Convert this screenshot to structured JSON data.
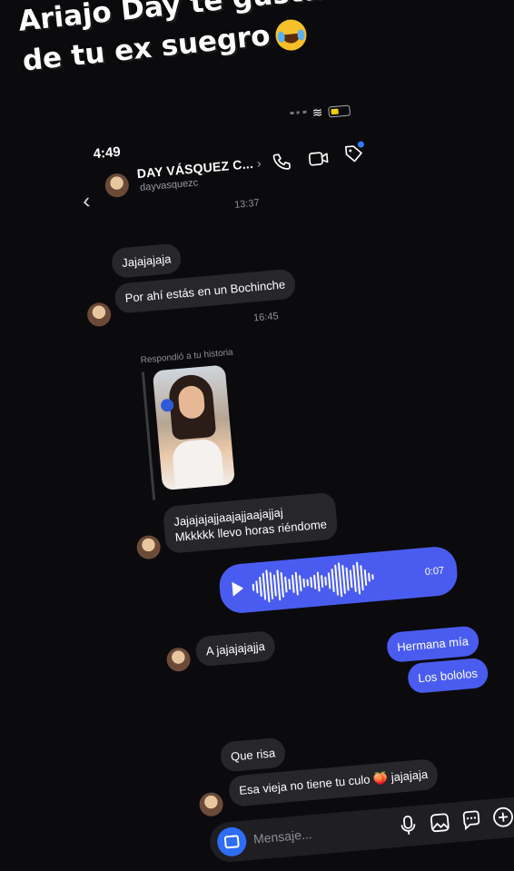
{
  "caption": "Ariajo Day te gusta los bololos de tu ex suegro",
  "status": {
    "time": "4:49"
  },
  "header": {
    "name": "DAY VÁSQUEZ C...",
    "chevron": "›",
    "username": "dayvasquezc",
    "back_icon": "‹"
  },
  "times": [
    "13:37",
    "16:45"
  ],
  "messages": {
    "m1": "Jajajajaja",
    "m2": "Por ahí estás en un Bochinche",
    "reply_label": "Respondió a tu historia",
    "m3_line1": "Jajajajajjaajajjaajajjaj",
    "m3_line2": "Mkkkkk llevo horas riéndome",
    "voice_duration": "0:07",
    "m4": "A jajajajajja",
    "out1": "Hermana mía",
    "out2": "Los bololos",
    "m5": "Que risa",
    "m6": "Esa vieja no tiene tu culo 🍑 jajajaja"
  },
  "composer": {
    "placeholder": "Mensaje..."
  },
  "icons": [
    "back-icon",
    "phone-icon",
    "video-icon",
    "tag-icon",
    "camera-icon",
    "mic-icon",
    "image-icon",
    "sticker-icon",
    "plus-icon",
    "play-icon",
    "laughing-emoji-icon"
  ],
  "colors": {
    "outgoing": "#4a5cf0",
    "incoming": "#26262b",
    "background": "#0b0b0e",
    "accent": "#2f7cf7"
  }
}
